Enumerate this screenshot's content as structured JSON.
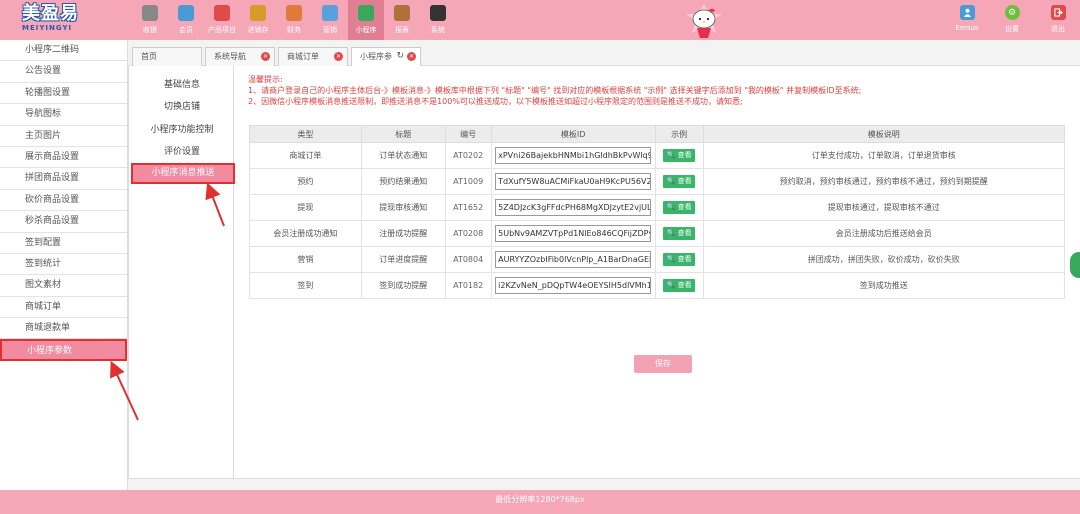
{
  "brand": {
    "name_cn": "美盈易",
    "name_en": "MEIYINGYI"
  },
  "nav": [
    {
      "label": "收银",
      "icon": "register-icon",
      "color": "#888888"
    },
    {
      "label": "会员",
      "icon": "member-icon",
      "color": "#4a9ad8"
    },
    {
      "label": "产品项目",
      "icon": "product-icon",
      "color": "#e04a4a"
    },
    {
      "label": "进销存",
      "icon": "inventory-icon",
      "color": "#d89a2a"
    },
    {
      "label": "财务",
      "icon": "finance-icon",
      "color": "#e07a3a"
    },
    {
      "label": "营销",
      "icon": "marketing-icon",
      "color": "#5aa0e0"
    },
    {
      "label": "小程序",
      "icon": "miniapp-icon",
      "color": "#3aa85a"
    },
    {
      "label": "报表",
      "icon": "report-icon",
      "color": "#b0703a"
    },
    {
      "label": "系统",
      "icon": "system-icon",
      "color": "#333333"
    }
  ],
  "nav_active": "小程序",
  "right_nav": {
    "user_label": "Eersus",
    "settings_label": "设置",
    "logout_label": "退出"
  },
  "sidebar": {
    "items": [
      "小程序二维码",
      "公告设置",
      "轮播图设置",
      "导航图标",
      "主页图片",
      "展示商品设置",
      "拼团商品设置",
      "砍价商品设置",
      "秒杀商品设置",
      "签到配置",
      "签到统计",
      "图文素材",
      "商城订单",
      "商城退款单",
      "小程序参数"
    ],
    "active": "小程序参数"
  },
  "tabs": [
    {
      "label": "首页"
    },
    {
      "label": "系统导航"
    },
    {
      "label": "商城订单"
    },
    {
      "label": "小程序参"
    }
  ],
  "submenu": {
    "items": [
      "基础信息",
      "切换店铺",
      "小程序功能控制",
      "评价设置",
      "小程序消息推送"
    ],
    "active": "小程序消息推送"
  },
  "tips": {
    "title": "温馨提示:",
    "line1": "1、请商户登录自己的小程序主体后台-》模板消息-》模板库中根据下列 \"标题\" \"编号\" 找到对应的模板根据系统 \"示例\" 选择关键字后添加到 \"我的模板\" 并复制模板ID至系统;",
    "line2": "2、因微信小程序模板消息推送限制，即推送消息不是100%可以推送成功，以下模板推送如超过小程序限定的范围则是推送不成功，请知悉;"
  },
  "table": {
    "headers": [
      "类型",
      "标题",
      "编号",
      "模板ID",
      "示例",
      "模板说明"
    ],
    "view_label": "查看",
    "rows": [
      {
        "type": "商城订单",
        "title": "订单状态通知",
        "code": "AT0202",
        "template_id": "xPVni26BajekbHNMbi1hGldhBkPvWlq9Fdj",
        "desc": "订单支付成功，订单取消，订单退货审核"
      },
      {
        "type": "预约",
        "title": "预约结果通知",
        "code": "AT1009",
        "template_id": "TdXufY5W8uACMiFkaU0aH9KcPU56V2Pz",
        "desc": "预约取消，预约审核通过，预约审核不通过，预约到期提醒"
      },
      {
        "type": "提现",
        "title": "提现审核通知",
        "code": "AT1652",
        "template_id": "5Z4DJzcK3gFFdcPH68MgXDJzytE2vjULt",
        "desc": "提现审核通过，提现审核不通过"
      },
      {
        "type": "会员注册成功通知",
        "title": "注册成功提醒",
        "code": "AT0208",
        "template_id": "5UbNv9AMZVTpPd1NlEo846CQFijZDPyy5",
        "desc": "会员注册成功后推送给会员"
      },
      {
        "type": "营销",
        "title": "订单进度提醒",
        "code": "AT0804",
        "template_id": "AURYYZOzbIFib0lVcnPlp_A1BarDnaGEirc",
        "desc": "拼团成功，拼团失败，砍价成功，砍价失败"
      },
      {
        "type": "签到",
        "title": "签到成功提醒",
        "code": "AT0182",
        "template_id": "i2KZvNeN_pDQpTW4eOEYSIH5dlVMh1ffM",
        "desc": "签到成功推送"
      }
    ]
  },
  "save_label": "保存",
  "footer": "最低分辨率1280*768px",
  "colors": {
    "topbar": "#f5a7b7",
    "highlight_border": "#e03030",
    "active_pink": "#f28aa0",
    "view_green": "#39b56a",
    "tip_red": "#e04040"
  }
}
